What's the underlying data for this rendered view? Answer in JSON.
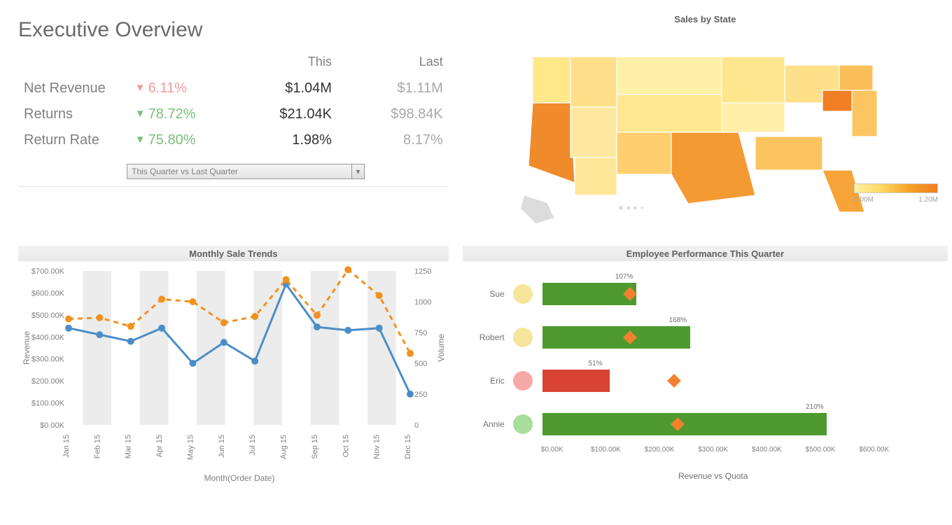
{
  "page_title": "Executive Overview",
  "kpi": {
    "col_this": "This",
    "col_last": "Last",
    "rows": [
      {
        "label": "Net Revenue",
        "dir": "down-bad",
        "delta": "6.11%",
        "this": "$1.04M",
        "last": "$1.11M"
      },
      {
        "label": "Returns",
        "dir": "down-good",
        "delta": "78.72%",
        "this": "$21.04K",
        "last": "$98.84K"
      },
      {
        "label": "Return Rate",
        "dir": "down-good",
        "delta": "75.80%",
        "this": "1.98%",
        "last": "8.17%"
      }
    ]
  },
  "period_selector": {
    "label": "This Quarter vs Last Quarter"
  },
  "map": {
    "title": "Sales by State",
    "legend_min": "0.00M",
    "legend_max": "1.20M"
  },
  "trends": {
    "title": "Monthly Sale Trends",
    "xlabel": "Month(Order Date)",
    "ylabel_left": "Revenue",
    "ylabel_right": "Volume"
  },
  "performance": {
    "title": "Employee Performance This Quarter",
    "xlabel": "Revenue vs Quota"
  },
  "chart_data": [
    {
      "id": "monthly_sale_trends",
      "type": "line",
      "categories": [
        "Jan 15",
        "Feb 15",
        "Mar 15",
        "Apr 15",
        "May 15",
        "Jun 15",
        "Jul 15",
        "Aug 15",
        "Sep 15",
        "Oct 15",
        "Nov 15",
        "Dec 15"
      ],
      "series": [
        {
          "name": "Revenue",
          "axis": "left",
          "style": "solid",
          "color": "#4b8ec7",
          "values": [
            440000,
            410000,
            380000,
            440000,
            280000,
            375000,
            290000,
            640000,
            445000,
            430000,
            440000,
            140000
          ]
        },
        {
          "name": "Volume",
          "axis": "right",
          "style": "dashed",
          "color": "#f2911f",
          "values": [
            860,
            870,
            800,
            1020,
            1000,
            830,
            880,
            1180,
            890,
            1260,
            1050,
            580
          ]
        }
      ],
      "ylim_left": [
        0,
        700000
      ],
      "ylim_right": [
        0,
        1250
      ],
      "y_ticks_left": [
        "$0.00K",
        "$100.00K",
        "$200.00K",
        "$300.00K",
        "$400.00K",
        "$500.00K",
        "$600.00K",
        "$700.00K"
      ],
      "y_ticks_right": [
        "0",
        "250",
        "500",
        "750",
        "1000",
        "1250"
      ]
    },
    {
      "id": "employee_performance",
      "type": "bar",
      "orientation": "horizontal",
      "xlim": [
        0,
        600000
      ],
      "x_ticks": [
        "$0.00K",
        "$100.00K",
        "$200.00K",
        "$300.00K",
        "$400.00K",
        "$500.00K",
        "$600.00K"
      ],
      "rows": [
        {
          "name": "Sue",
          "pct_of_quota": 107,
          "revenue": 175000,
          "quota": 164000,
          "status": "pass"
        },
        {
          "name": "Robert",
          "pct_of_quota": 168,
          "revenue": 275000,
          "quota": 164000,
          "status": "pass"
        },
        {
          "name": "Eric",
          "pct_of_quota": 51,
          "revenue": 125000,
          "quota": 245000,
          "status": "fail"
        },
        {
          "name": "Annie",
          "pct_of_quota": 210,
          "revenue": 530000,
          "quota": 252000,
          "status": "pass"
        }
      ],
      "colors": {
        "pass_bar": "#4f9a2f",
        "fail_bar": "#d84332",
        "quota_marker": "#f2812f",
        "dot_pass_light": "#f7e59b",
        "dot_fail": "#f6a9a6",
        "dot_pass_strong": "#a9dd9a"
      }
    },
    {
      "id": "sales_by_state",
      "type": "choropleth",
      "geography": "US states",
      "value_label": "Sales",
      "scale": {
        "min": 0,
        "max": 1200000,
        "colors": [
          "#fff29a",
          "#ef7f22"
        ]
      },
      "note": "California, Texas, Florida and Pennsylvania highest; mountain/plains states lowest"
    }
  ]
}
